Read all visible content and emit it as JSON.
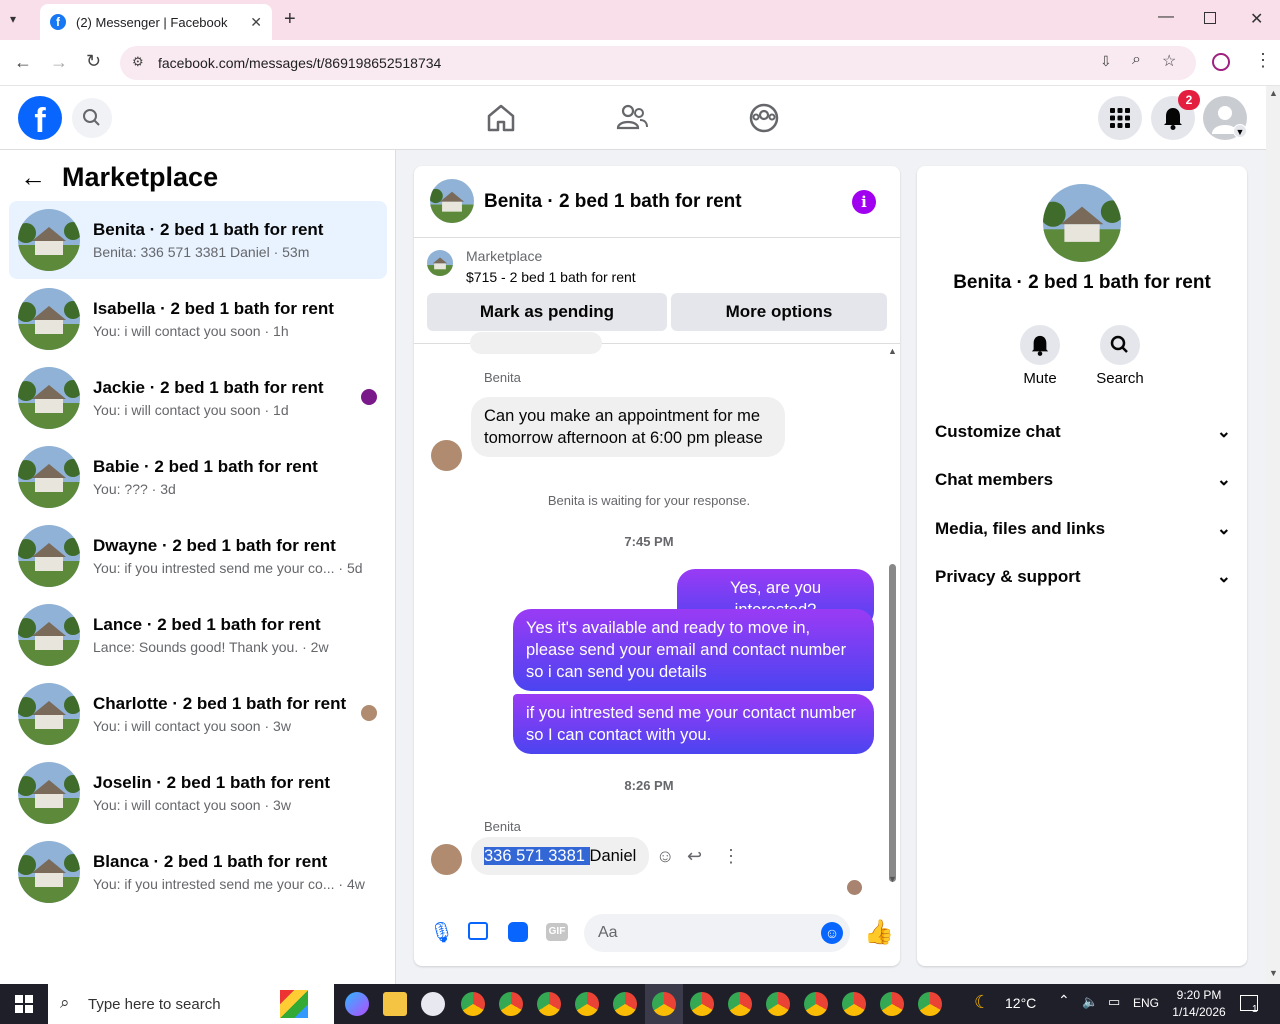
{
  "browser": {
    "tab_title": "(2) Messenger | Facebook",
    "url": "facebook.com/messages/t/869198652518734"
  },
  "header": {
    "notification_count": "2"
  },
  "left": {
    "title": "Marketplace",
    "conversations": [
      {
        "name": "Benita · 2 bed 1 bath for rent",
        "preview": "Benita: 336 571 3381 Daniel",
        "time": "· 53m"
      },
      {
        "name": "Isabella · 2 bed 1 bath for rent",
        "preview": "You: i will contact you soon",
        "time": "· 1h"
      },
      {
        "name": "Jackie · 2 bed 1 bath for rent",
        "preview": "You: i will contact you soon",
        "time": "· 1d"
      },
      {
        "name": "Babie · 2 bed 1 bath for rent",
        "preview": "You: ???",
        "time": "· 3d"
      },
      {
        "name": "Dwayne · 2 bed 1 bath for rent",
        "preview": "You: if you intrested send me your co...",
        "time": "· 5d"
      },
      {
        "name": "Lance · 2 bed 1 bath for rent",
        "preview": "Lance: Sounds good! Thank you.",
        "time": "· 2w"
      },
      {
        "name": "Charlotte · 2 bed 1 bath for rent",
        "preview": "You: i will contact you soon",
        "time": "· 3w"
      },
      {
        "name": "Joselin · 2 bed 1 bath for rent",
        "preview": "You: i will contact you soon",
        "time": "· 3w"
      },
      {
        "name": "Blanca · 2 bed 1 bath for rent",
        "preview": "You: if you intrested send me your co...",
        "time": "· 4w"
      }
    ]
  },
  "chat": {
    "title": "Benita · 2 bed 1 bath for rent",
    "listing_source": "Marketplace",
    "listing_price": "$715 - 2 bed 1 bath for rent",
    "mark_pending": "Mark as pending",
    "more_options": "More options",
    "sender1": "Benita",
    "msg_in1": "Can you make an appointment for me tomorrow  afternoon  at 6:00 pm please",
    "waiting": "Benita is waiting for your response.",
    "time1": "7:45 PM",
    "msg_out1": "Yes, are you interested?",
    "msg_out2": "Yes it's available and ready to move in, please send your email and contact number so i can send you details",
    "msg_out3": "if you intrested send me your contact number so I can contact with you.",
    "time2": "8:26 PM",
    "sender2": "Benita",
    "msg_in2_selected": "336 571 3381 ",
    "msg_in2_rest": "Daniel",
    "composer_placeholder": "Aa"
  },
  "right": {
    "title": "Benita · 2 bed 1 bath for rent",
    "mute": "Mute",
    "search": "Search",
    "sections": [
      "Customize chat",
      "Chat members",
      "Media, files and links",
      "Privacy & support"
    ]
  },
  "taskbar": {
    "search_placeholder": "Type here to search",
    "weather": "12°C",
    "lang": "ENG",
    "time": "9:20 PM",
    "date": "1/14/2026",
    "notif": "1"
  },
  "colors": {
    "accent": "#0866ff",
    "bubble_out_top": "#9a3bf5",
    "bubble_out_bottom": "#4b44f0",
    "selected_row": "#e9f3ff"
  }
}
